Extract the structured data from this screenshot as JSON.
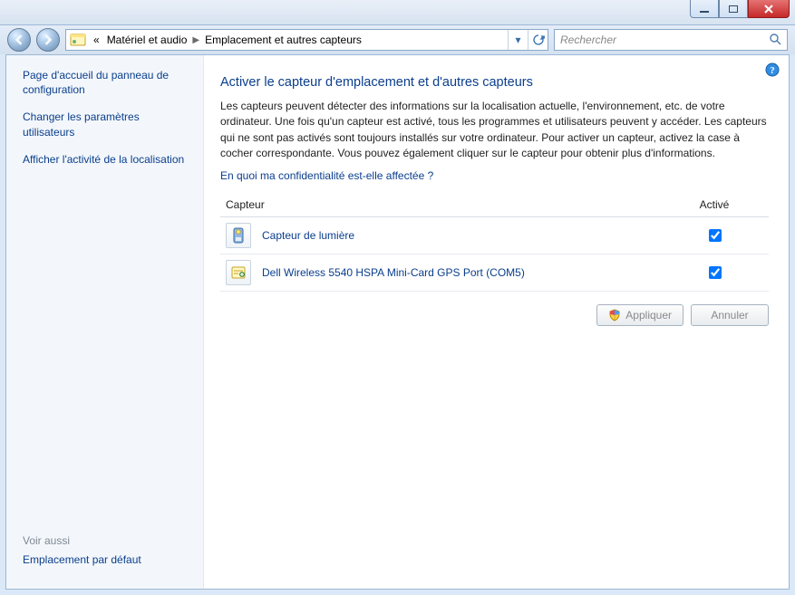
{
  "titlebar": {},
  "nav": {
    "breadcrumb_prefix": "«",
    "crumb1": "Matériel et audio",
    "crumb2": "Emplacement et autres capteurs",
    "search_placeholder": "Rechercher"
  },
  "sidebar": {
    "links": [
      {
        "label": "Page d'accueil du panneau de configuration"
      },
      {
        "label": "Changer les paramètres utilisateurs"
      },
      {
        "label": "Afficher l'activité de la localisation"
      }
    ],
    "seealso_head": "Voir aussi",
    "seealso_item": "Emplacement par défaut"
  },
  "main": {
    "title": "Activer le capteur d'emplacement et d'autres capteurs",
    "description": "Les capteurs peuvent détecter des informations sur la localisation actuelle, l'environnement, etc. de votre ordinateur. Une fois qu'un capteur est activé, tous les programmes et utilisateurs peuvent y accéder. Les capteurs qui ne sont pas activés sont toujours installés sur votre ordinateur. Pour activer un capteur, activez la case à cocher correspondante. Vous pouvez également cliquer sur le capteur pour obtenir plus d'informations.",
    "confidentiality_link": "En quoi ma confidentialité est-elle affectée ?",
    "table": {
      "col_sensor": "Capteur",
      "col_active": "Activé",
      "rows": [
        {
          "name": "Capteur de lumière",
          "active": true,
          "icon": "light-sensor-icon"
        },
        {
          "name": "Dell Wireless 5540 HSPA Mini-Card GPS Port (COM5)",
          "active": true,
          "icon": "gps-icon"
        }
      ]
    },
    "buttons": {
      "apply": "Appliquer",
      "cancel": "Annuler"
    }
  }
}
